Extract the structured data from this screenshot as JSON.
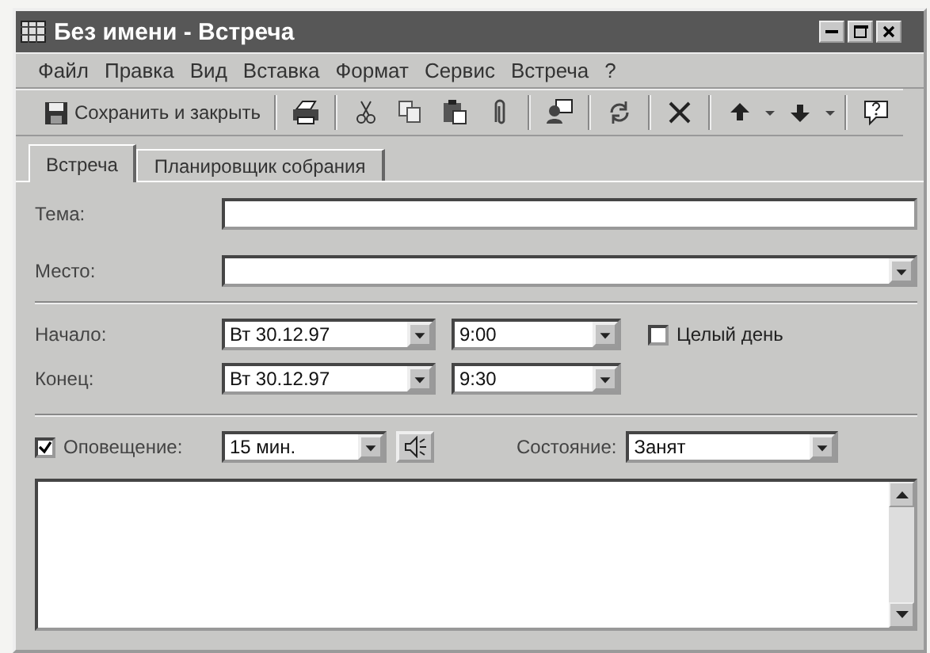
{
  "window": {
    "title": "Без имени - Встреча"
  },
  "menu": [
    "Файл",
    "Правка",
    "Вид",
    "Вставка",
    "Формат",
    "Сервис",
    "Встреча",
    "?"
  ],
  "toolbar": {
    "save_label": "Сохранить и закрыть"
  },
  "tabs": [
    {
      "label": "Встреча",
      "selected": true
    },
    {
      "label": "Планировщик собрания",
      "selected": false
    }
  ],
  "subject": {
    "label": "Тема:"
  },
  "location": {
    "label": "Место:"
  },
  "start": {
    "label": "Начало:",
    "date": "Вт 30.12.97",
    "time": "9:00"
  },
  "all_day": {
    "label": "Целый день",
    "checked": false
  },
  "end": {
    "label": "Конец:",
    "date": "Вт 30.12.97",
    "time": "9:30"
  },
  "reminder": {
    "label": "Оповещение:",
    "checked": true,
    "value": "15 мин."
  },
  "status": {
    "label": "Состояние:",
    "value": "Занят"
  }
}
